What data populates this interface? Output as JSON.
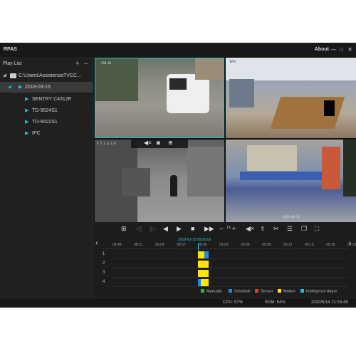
{
  "app": {
    "title": "RPAS",
    "about": "About"
  },
  "window_controls": {
    "minimize": "—",
    "restore": "□",
    "close": "✕"
  },
  "sidebar": {
    "title": "Play List",
    "add": "+",
    "remove": "−",
    "tree": {
      "path": "C:\\Users\\AssistenzaTVCC...",
      "date": "2018-03-15",
      "devices": [
        "SENTRY C4312E",
        "TD-9524S1",
        "TD-9422S1",
        "IPC"
      ]
    }
  },
  "cameras": [
    {
      "label": "CAM 01"
    },
    {
      "label": "TVCC"
    },
    {
      "label": "V T 1 4 3 0"
    },
    {
      "label": "2018-03-15"
    }
  ],
  "camera_toolbar": {
    "icons": [
      "mute-icon",
      "snapshot-icon",
      "zoom-in-icon"
    ]
  },
  "playback": {
    "speed": "1X",
    "icons": [
      "split-screen-icon",
      "frame-back-icon",
      "frame-forward-icon",
      "rewind-icon",
      "play-icon",
      "stop-icon",
      "fast-forward-icon",
      "speed-down-icon",
      "speed-up-icon",
      "mute-icon",
      "export-icon",
      "clip-icon",
      "playlist-icon",
      "window-icon",
      "fullscreen-icon"
    ]
  },
  "timeline": {
    "cursor_time": "2018-03-15 09:00:00",
    "ticks": [
      "08:48",
      "08:51",
      "08:54",
      "08:57",
      "09:00",
      "09:03",
      "09:06",
      "09:09",
      "09:12",
      "09:15",
      "09:18",
      "09:21"
    ],
    "channels": [
      "1",
      "2",
      "3",
      "4"
    ],
    "colors": {
      "manually": "#27c13a",
      "schedule": "#1e88e5",
      "sensor": "#e53935",
      "motion": "#ffe500",
      "intelligence": "#19c4d8"
    }
  },
  "legend": [
    {
      "label": "Manually",
      "color": "#27c13a"
    },
    {
      "label": "Schedule",
      "color": "#1e88e5"
    },
    {
      "label": "Sensor",
      "color": "#e53935"
    },
    {
      "label": "Motion",
      "color": "#ffe500"
    },
    {
      "label": "Intelligence Alarm",
      "color": "#19c4d8"
    }
  ],
  "status": {
    "cpu": "CPU: 57%",
    "ram": "RAM: 54%",
    "datetime": "2020/5/14 21:53:45"
  }
}
